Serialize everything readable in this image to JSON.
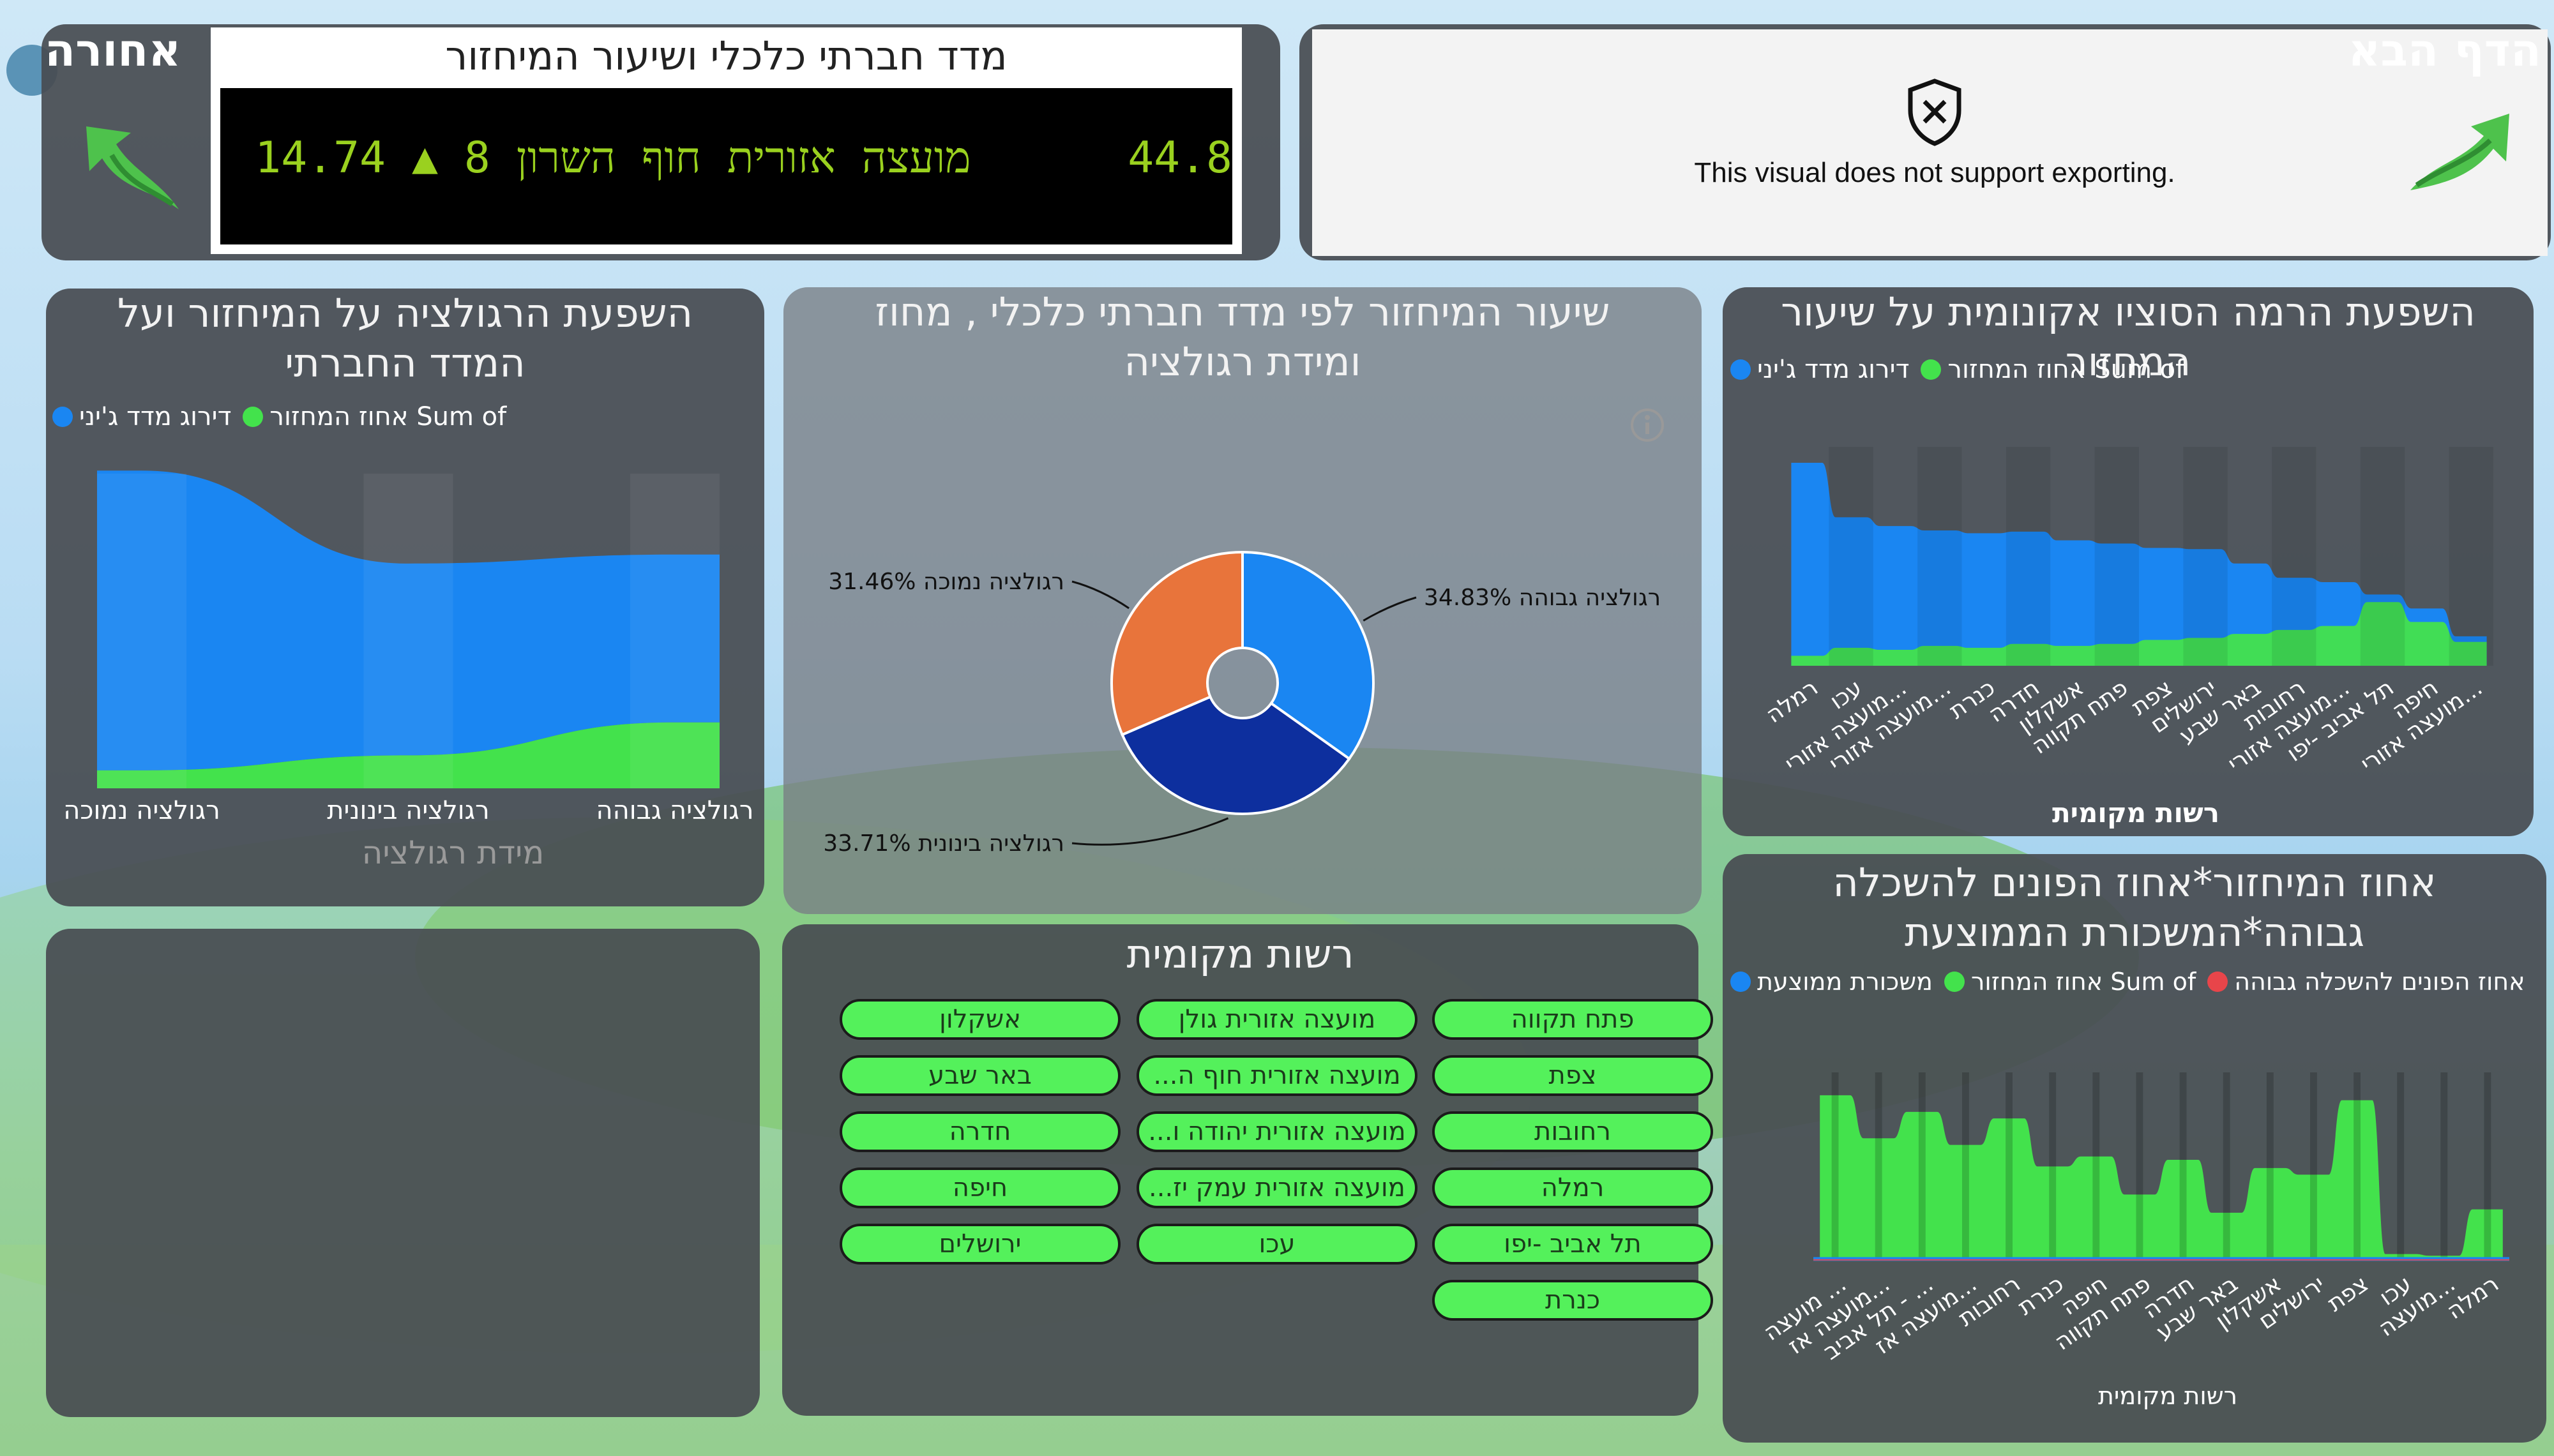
{
  "nav": {
    "back_label": "אחורה",
    "next_label": "הדף הבא"
  },
  "ticker": {
    "title": "מדד חברתי כלכלי ושיעור המיחזור",
    "text": "44.8      מועצה אזורית חוף השרון 8 ▲ 14.74"
  },
  "export_notice": {
    "message": "This visual does not support exporting."
  },
  "colors": {
    "blue": "#1a86f2",
    "green": "#43e24c",
    "darkblue": "#0d2f9e",
    "orange": "#e8743b",
    "red": "#e8454a"
  },
  "charts": {
    "regulation_ribbon": {
      "title": "השפעת הרגולציה על המיחזור ועל המדד החברתי"
    },
    "pie": {
      "title": "שיעור המיחזור לפי מדד חברתי כלכלי , מחוז ומידת רגולציה"
    },
    "socio": {
      "title": "השפעת הרמה הסוציו אקונומית על שיעור המחזור"
    },
    "education": {
      "title": "אחוז המיחזור*אחוז הפונים להשכלה גבוהה*המשכורת הממוצעת"
    }
  },
  "slicer": {
    "title": "רשות מקומית",
    "items": [
      "פתח תקווה",
      "מועצה אזורית גולן",
      "אשקלון",
      "צפת",
      "מועצה אזורית חוף ה...",
      "באר שבע",
      "רחובות",
      "מועצה אזורית יהודה ו...",
      "חדרה",
      "רמלה",
      "מועצה אזורית עמק יז...",
      "חיפה",
      "תל אביב -יפו",
      "עכו",
      "ירושלים",
      "כנרת"
    ]
  },
  "chart_data": [
    {
      "type": "area",
      "title": "השפעת הרגולציה על המיחזור ועל המדד החברתי",
      "xlabel": "מידת רגולציה",
      "categories": [
        "רגולציה נמוכה",
        "רגולציה בינונית",
        "רגולציה גבוהה"
      ],
      "legend": [
        "דירוג מדד ג'יני",
        "Sum of אחוז המחזור"
      ],
      "series": [
        {
          "name": "דירוג מדד ג'יני",
          "values": [
            100,
            64,
            56
          ]
        },
        {
          "name": "Sum of אחוז המחזור",
          "values": [
            6,
            11,
            22
          ]
        }
      ],
      "ylim": [
        0,
        105
      ]
    },
    {
      "type": "pie",
      "title": "שיעור המיחזור לפי מדד חברתי כלכלי , מחוז ומידת רגולציה",
      "slices": [
        {
          "label": "רגולציה גבוהה",
          "value": 34.83,
          "text": "רגולציה גבוהה 34.83%"
        },
        {
          "label": "רגולציה בינונית",
          "value": 33.71,
          "text": "33.71% רגולציה בינונית"
        },
        {
          "label": "רגולציה נמוכה",
          "value": 31.46,
          "text": "31.46% רגולציה נמוכה"
        }
      ]
    },
    {
      "type": "area",
      "title": "השפעת הרמה הסוציו אקונומית על שיעור המחזור",
      "xlabel": "רשות מקומית",
      "legend": [
        "דירוג מדד ג'יני",
        "Sum of אחוז המחזור"
      ],
      "categories": [
        "רמלה",
        "עכו",
        "מועצה אזורי...",
        "מועצה אזורי...",
        "כנרת",
        "חדרה",
        "אשקלון",
        "פתח תקווה",
        "צפת",
        "ירושלים",
        "באר שבע",
        "רחובות",
        "מועצה אזורי...",
        "תל אביב -יפו",
        "חיפה",
        "מועצה אזורי..."
      ],
      "series": [
        {
          "name": "דירוג מדד ג'יני",
          "values": [
            100,
            71,
            67,
            64,
            63,
            63,
            59,
            57,
            54,
            53,
            45,
            37,
            34,
            23,
            20,
            10
          ]
        },
        {
          "name": "Sum of אחוז המחזור",
          "values": [
            5,
            9,
            8,
            10,
            9,
            11,
            10,
            11,
            13,
            14,
            16,
            18,
            20,
            32,
            22,
            12
          ]
        }
      ],
      "ylim": [
        0,
        110
      ]
    },
    {
      "type": "area",
      "title": "אחוז המיחזור*אחוז הפונים להשכלה גבוהה*המשכורת הממוצעת",
      "xlabel": "רשות מקומית",
      "legend": [
        "משכורת ממוצעת",
        "Sum of אחוז המחזור",
        "אחוז הפונים להשכלה גבוהה"
      ],
      "categories": [
        "מועצה ...",
        "מועצה אז...",
        "תל אביב - ...",
        "מועצה אז...",
        "רחובות",
        "כנרת",
        "חיפה",
        "פתח תקווה",
        "חדרה",
        "באר שבע",
        "אשקלון",
        "ירושלים",
        "צפת",
        "עכו",
        "מועצה...",
        "רמלה"
      ],
      "series": [
        {
          "name": "Sum of אחוז המחזור",
          "values": [
            100,
            74,
            90,
            70,
            86,
            57,
            63,
            40,
            61,
            29,
            56,
            52,
            97,
            4,
            3,
            31
          ]
        },
        {
          "name": "משכורת ממוצעת",
          "values": [
            1,
            1,
            1,
            1,
            1,
            1,
            1,
            1,
            1,
            1,
            1,
            1,
            1,
            1,
            1,
            1
          ]
        },
        {
          "name": "אחוז הפונים להשכלה גבוהה",
          "values": [
            0.5,
            0.5,
            0.5,
            0.5,
            0.5,
            0.5,
            0.5,
            0.5,
            0.5,
            0.5,
            0.5,
            0.5,
            0.5,
            0.5,
            0.5,
            0.5
          ]
        }
      ],
      "ylim": [
        0,
        110
      ]
    }
  ]
}
